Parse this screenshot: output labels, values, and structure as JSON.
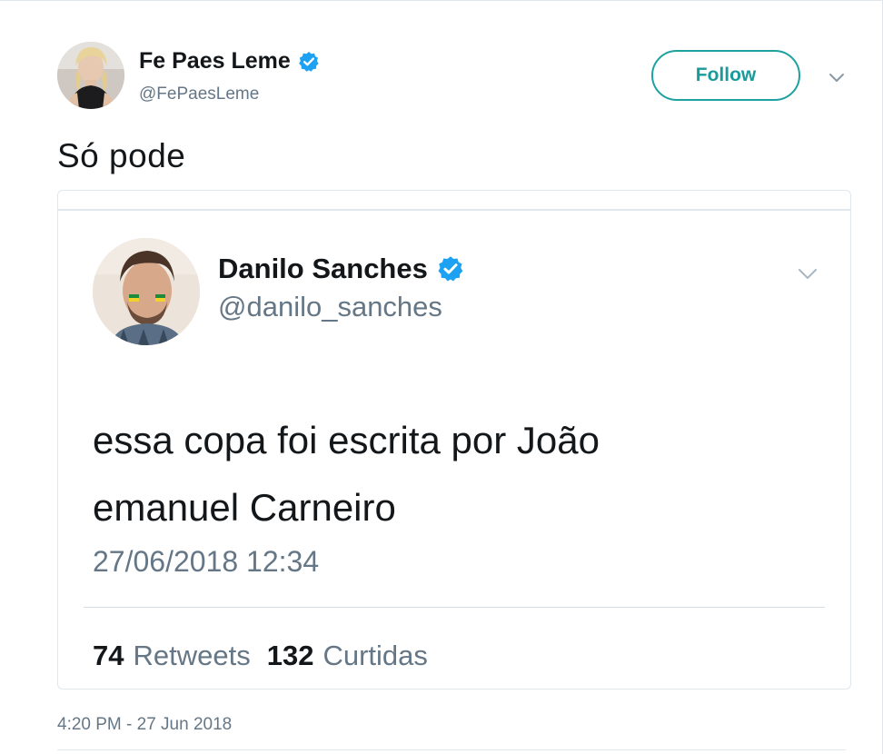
{
  "tweet": {
    "author": {
      "name": "Fe Paes Leme",
      "handle": "@FePaesLeme",
      "verified": true
    },
    "follow_label": "Follow",
    "text": "Só pode",
    "timestamp": "4:20 PM - 27 Jun 2018"
  },
  "quoted_tweet": {
    "author": {
      "name": "Danilo Sanches",
      "handle": "@danilo_sanches",
      "verified": true
    },
    "text": "essa copa foi escrita por João emanuel Carneiro",
    "date": "27/06/2018 12:34",
    "retweets_count": "74",
    "retweets_label": "Retweets",
    "likes_count": "132",
    "likes_label": "Curtidas"
  },
  "colors": {
    "accent": "#1da1a1",
    "verified": "#1da1f2",
    "secondary_text": "#657786",
    "border": "#e1e8ed"
  },
  "icons": {
    "verified": "verified-badge-icon",
    "caret": "chevron-down-icon"
  }
}
